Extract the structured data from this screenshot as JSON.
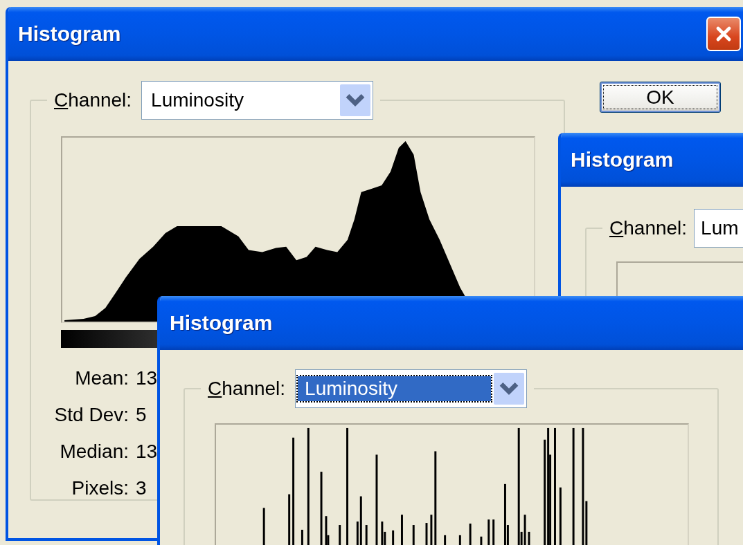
{
  "windows": [
    {
      "title": "Histogram",
      "close_button": true,
      "channel": {
        "label": "Channel:",
        "value": "Luminosity",
        "focused": false
      },
      "histogram": {
        "kind": "smooth",
        "gradient_bar": true
      },
      "stats": [
        {
          "label": "Mean:",
          "value": "13"
        },
        {
          "label": "Std Dev:",
          "value": "5"
        },
        {
          "label": "Median:",
          "value": "13"
        },
        {
          "label": "Pixels:",
          "value": "3"
        }
      ],
      "buttons": [
        {
          "label": "OK",
          "default": true
        }
      ]
    },
    {
      "title": "Histogram",
      "close_button": false,
      "channel": {
        "label": "Channel:",
        "value": "Lum",
        "focused": false
      },
      "histogram": {
        "kind": "empty",
        "gradient_bar": false
      }
    },
    {
      "title": "Histogram",
      "close_button": false,
      "channel": {
        "label": "Channel:",
        "value": "Luminosity",
        "focused": true
      },
      "histogram": {
        "kind": "spikes",
        "gradient_bar": false
      }
    }
  ]
}
